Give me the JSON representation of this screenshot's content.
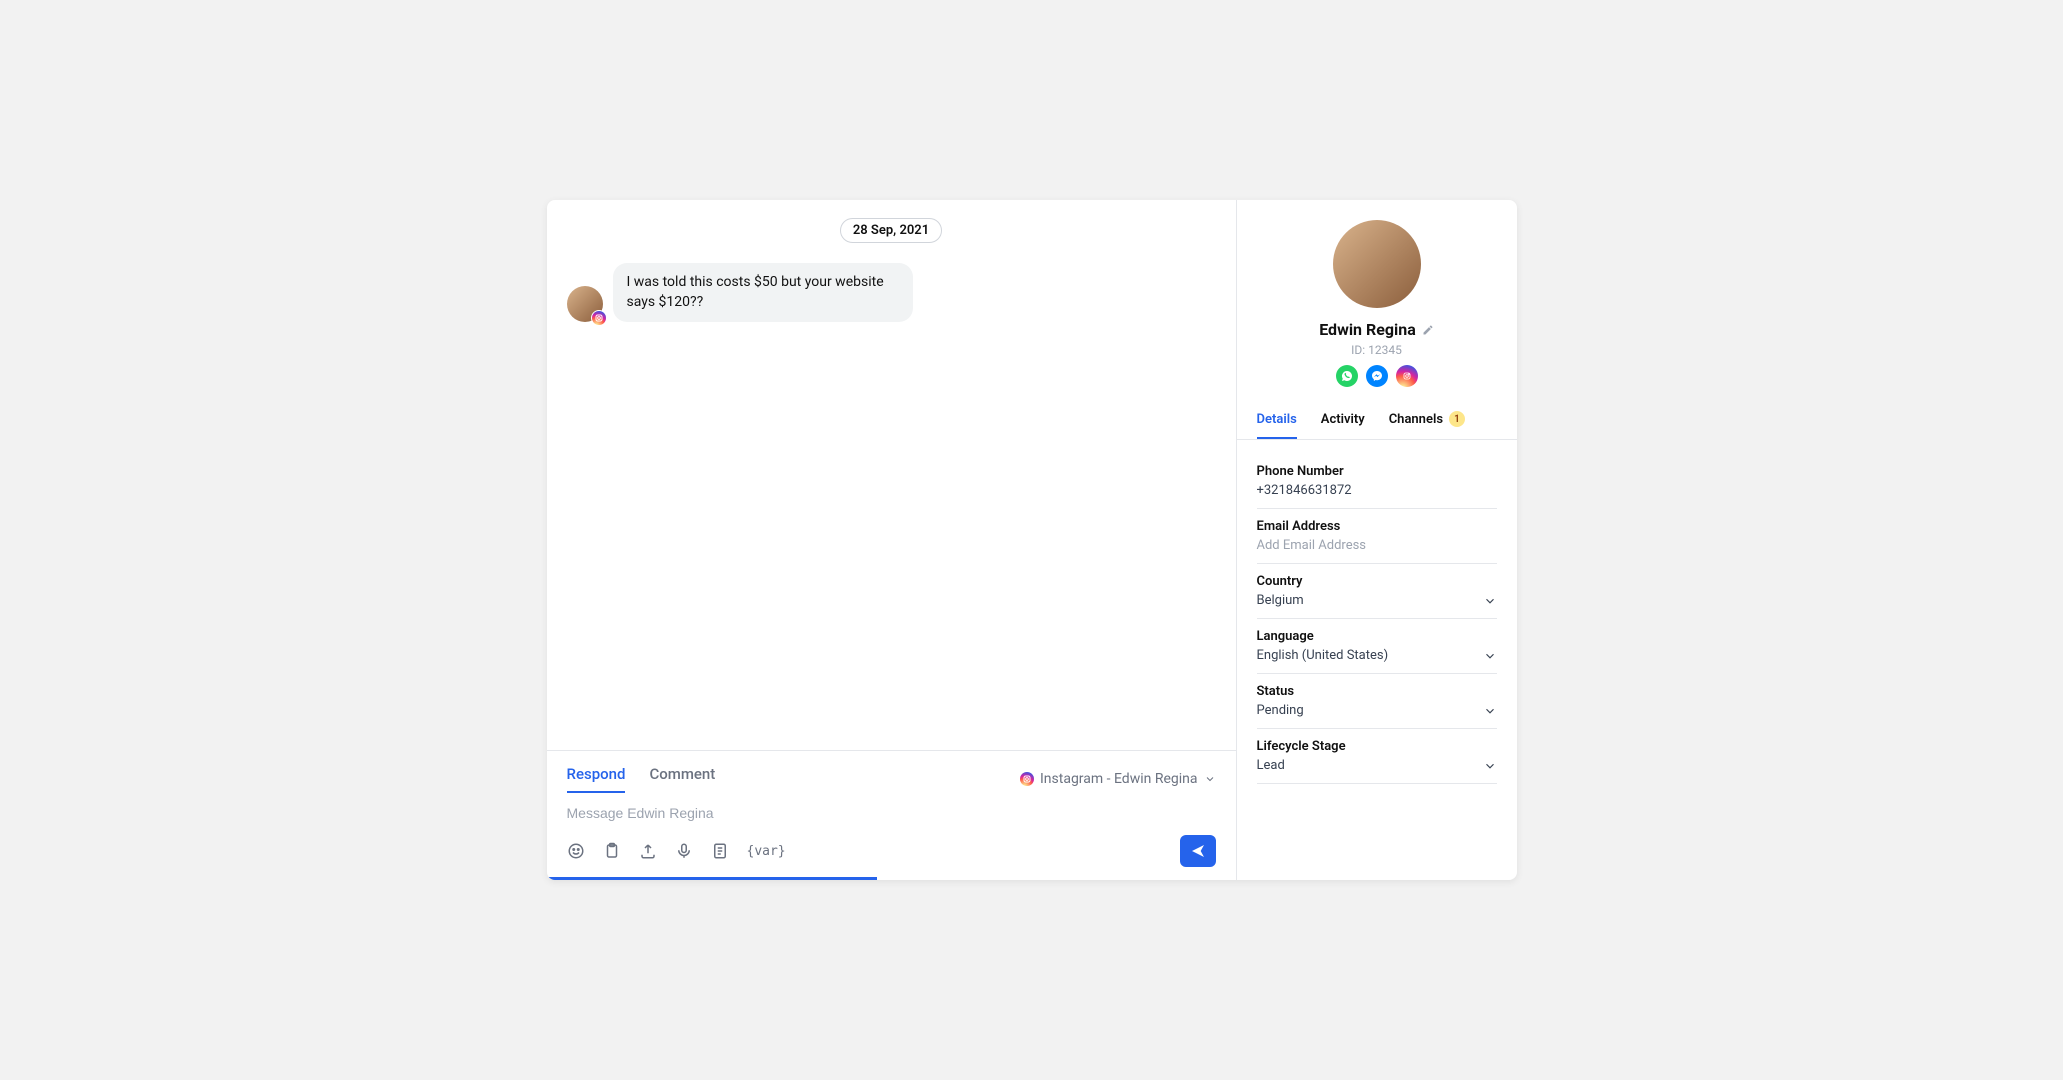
{
  "chat": {
    "date": "28 Sep, 2021",
    "messages": [
      {
        "text": "I was told this costs $50 but your website says $120??",
        "channel": "instagram"
      }
    ]
  },
  "composer": {
    "tabs": {
      "respond": "Respond",
      "comment": "Comment"
    },
    "channel_label": "Instagram - Edwin Regina",
    "placeholder": "Message Edwin Regina",
    "var_token": "{var}"
  },
  "profile": {
    "name": "Edwin Regina",
    "id_label": "ID: 12345",
    "channels": [
      "whatsapp",
      "messenger",
      "instagram"
    ]
  },
  "side_tabs": {
    "details": "Details",
    "activity": "Activity",
    "channels": "Channels",
    "channels_badge": "1"
  },
  "details": {
    "phone": {
      "label": "Phone Number",
      "value": "+321846631872"
    },
    "email": {
      "label": "Email Address",
      "placeholder": "Add Email Address"
    },
    "country": {
      "label": "Country",
      "value": "Belgium"
    },
    "language": {
      "label": "Language",
      "value": "English (United States)"
    },
    "status": {
      "label": "Status",
      "value": "Pending"
    },
    "lifecycle": {
      "label": "Lifecycle Stage",
      "value": "Lead"
    }
  }
}
